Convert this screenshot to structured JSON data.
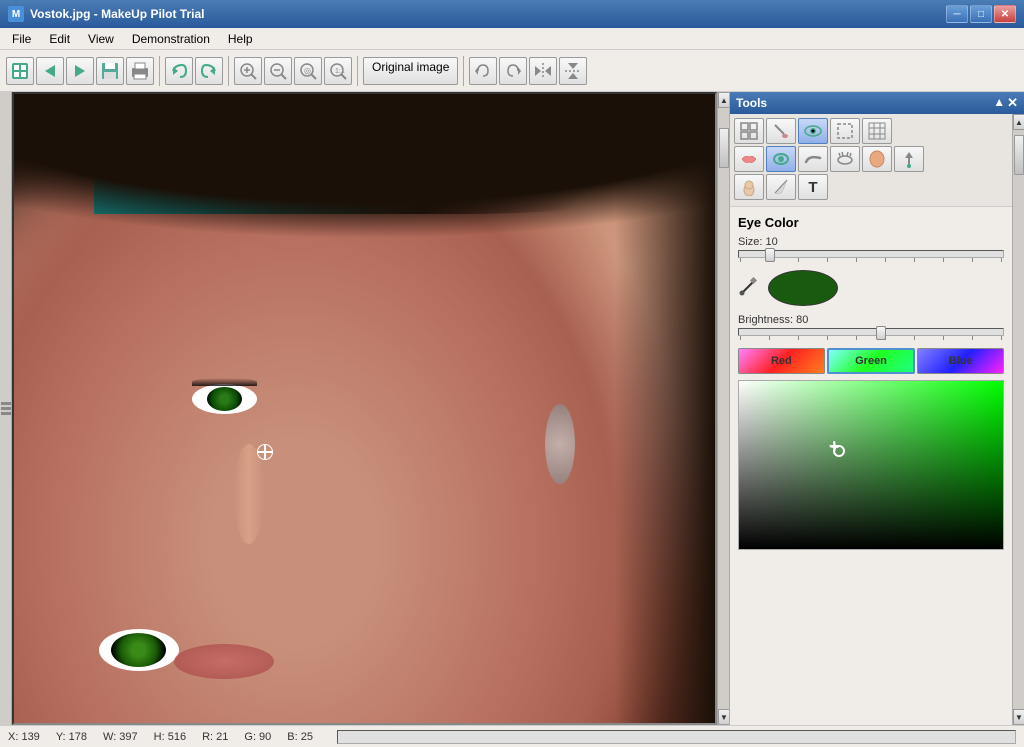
{
  "titleBar": {
    "title": "Vostok.jpg - MakeUp Pilot Trial",
    "minimizeLabel": "─",
    "maximizeLabel": "□",
    "closeLabel": "✕"
  },
  "menuBar": {
    "items": [
      "File",
      "Edit",
      "View",
      "Demonstration",
      "Help"
    ]
  },
  "toolbar": {
    "originalImageLabel": "Original image"
  },
  "toolsPanel": {
    "title": "Tools",
    "closeLabel": "✕",
    "upArrow": "▲",
    "sections": {
      "eyeColor": {
        "title": "Eye Color",
        "sizeLabel": "Size: 10",
        "brightnessLabel": "Brightness: 80"
      }
    },
    "rgbButtons": [
      "Red",
      "Green",
      "Blue"
    ],
    "scrollArrowUp": "▲",
    "scrollArrowDown": "▼"
  },
  "statusBar": {
    "x": "X: 139",
    "y": "Y: 178",
    "w": "W: 397",
    "h": "H: 516",
    "r": "R: 21",
    "g": "G: 90",
    "b": "B: 25"
  }
}
